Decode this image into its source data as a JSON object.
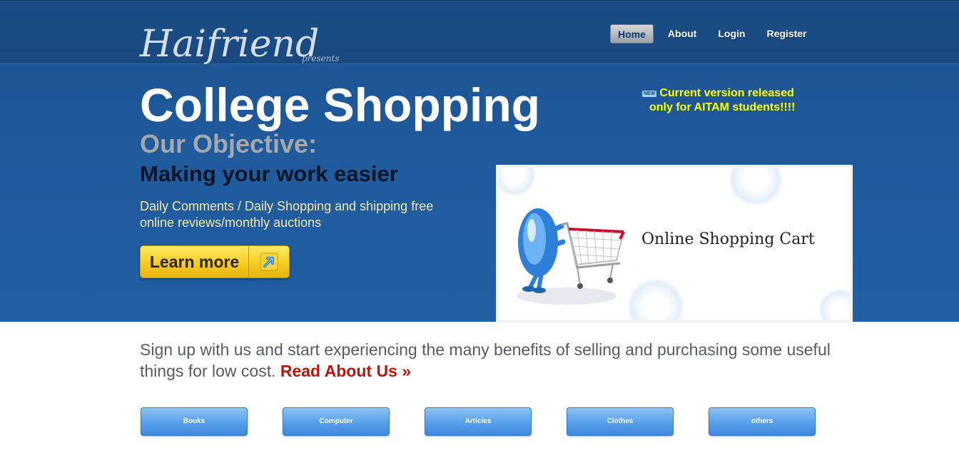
{
  "brand": {
    "logo": "Haifriend",
    "presents": "presents"
  },
  "nav": {
    "items": [
      "Home",
      "About",
      "Login",
      "Register"
    ],
    "active": "Home"
  },
  "hero": {
    "title": "College Shopping",
    "objective": "Our Objective:",
    "subhead": "Making your work easier",
    "desc_line1": "Daily Comments / Daily Shopping and shipping free",
    "desc_line2": "online reviews/monthly auctions",
    "cta_label": "Learn more",
    "cta_icon": "arrow-up-right-icon"
  },
  "announcement": {
    "badge": "NEW",
    "line1": "Current version released",
    "line2": "only for AITAM students!!!!"
  },
  "banner": {
    "caption": "Online Shopping Cart"
  },
  "signup": {
    "text": "Sign up with us and start experiencing the many benefits of selling and purchasing some useful things for low cost.",
    "link": "Read About Us »"
  },
  "categories": [
    "Books",
    "Computer",
    "Articles",
    "Clothes",
    "others"
  ],
  "colors": {
    "hero_blue": "#1f5a9c",
    "highlight_yellow": "#ffff00",
    "link_red": "#c0120c",
    "button_blue": "#5aa2ec"
  }
}
